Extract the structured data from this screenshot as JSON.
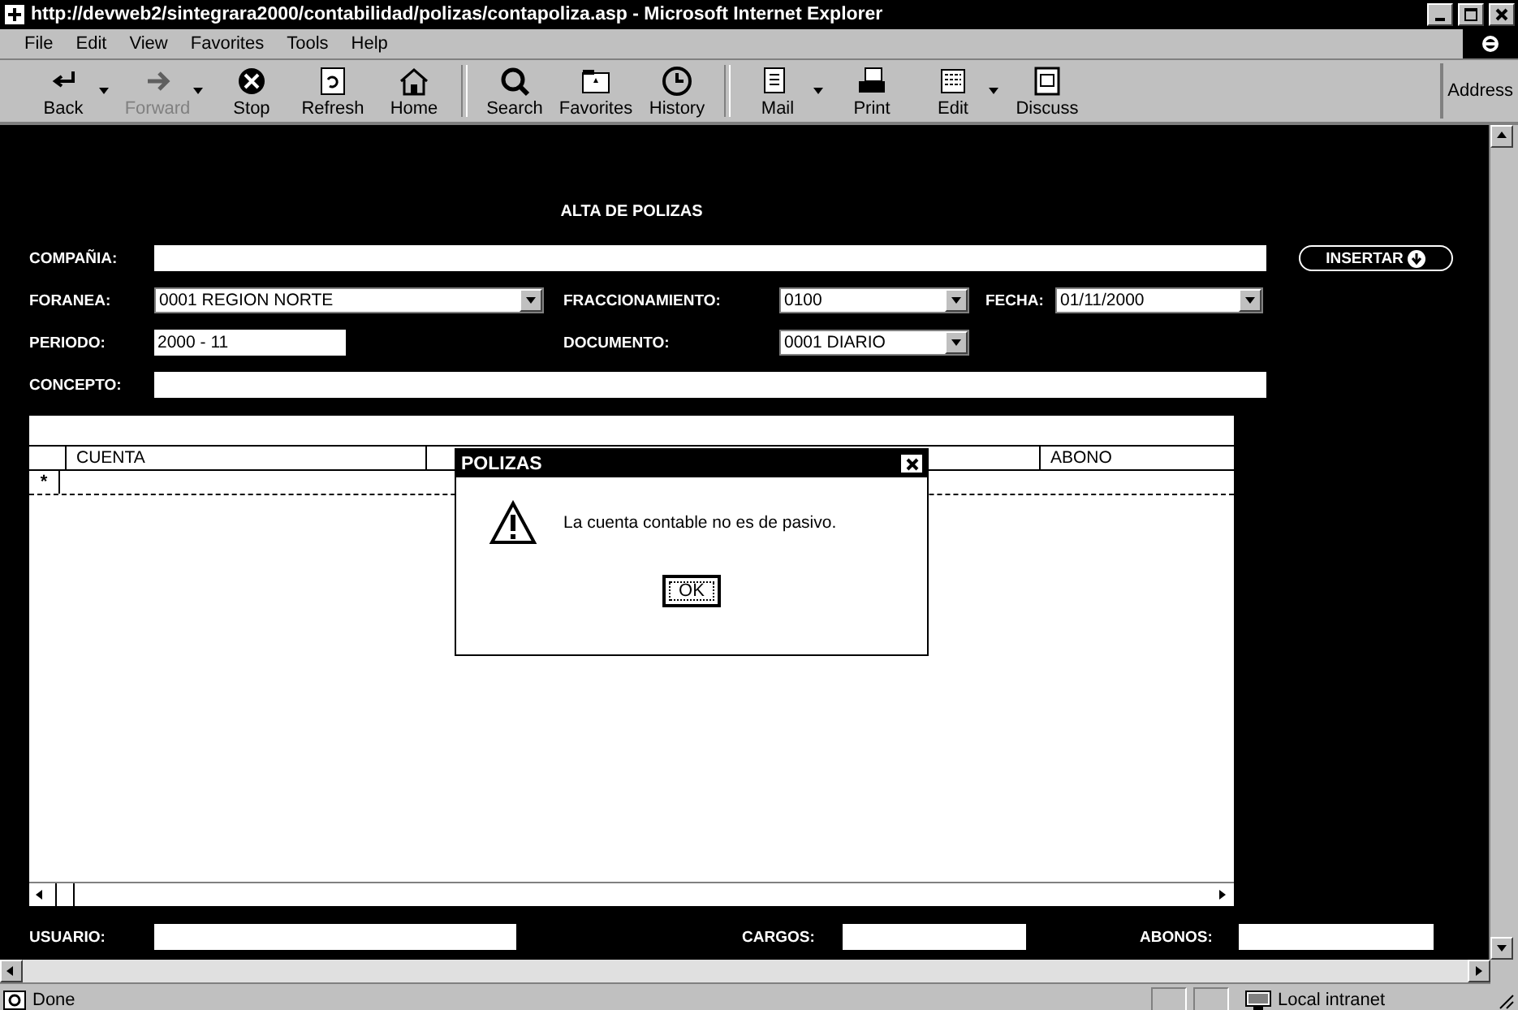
{
  "window": {
    "title": "http://devweb2/sintegrara2000/contabilidad/polizas/contapoliza.asp - Microsoft Internet Explorer"
  },
  "menu": [
    {
      "label": "File"
    },
    {
      "label": "Edit"
    },
    {
      "label": "View"
    },
    {
      "label": "Favorites"
    },
    {
      "label": "Tools"
    },
    {
      "label": "Help"
    }
  ],
  "toolbar": [
    {
      "label": "Back",
      "kind": "back",
      "dropdown": true,
      "disabled": false
    },
    {
      "label": "Forward",
      "kind": "forward",
      "dropdown": true,
      "disabled": true
    },
    {
      "label": "Stop",
      "kind": "stop",
      "dropdown": false,
      "disabled": false
    },
    {
      "label": "Refresh",
      "kind": "refresh",
      "dropdown": false,
      "disabled": false
    },
    {
      "label": "Home",
      "kind": "home",
      "dropdown": false,
      "disabled": false
    },
    {
      "label": "Search",
      "kind": "search",
      "dropdown": false,
      "disabled": false
    },
    {
      "label": "Favorites",
      "kind": "favorites",
      "dropdown": false,
      "disabled": false
    },
    {
      "label": "History",
      "kind": "history",
      "dropdown": false,
      "disabled": false
    },
    {
      "label": "Mail",
      "kind": "mail",
      "dropdown": true,
      "disabled": false
    },
    {
      "label": "Print",
      "kind": "print",
      "dropdown": false,
      "disabled": false
    },
    {
      "label": "Edit",
      "kind": "edit",
      "dropdown": true,
      "disabled": false
    },
    {
      "label": "Discuss",
      "kind": "discuss",
      "dropdown": false,
      "disabled": false
    }
  ],
  "address_label": "Address",
  "form": {
    "heading": "ALTA DE POLIZAS",
    "rows": [
      [
        {
          "kind": "label",
          "text": "COMPAÑIA:"
        },
        {
          "kind": "text"
        },
        {
          "kind": "button",
          "text": "INSERTAR"
        }
      ],
      [
        {
          "kind": "label",
          "text": "FORANEA:"
        },
        {
          "kind": "select",
          "value": "0001 REGION NORTE"
        },
        {
          "kind": "label",
          "text": "FRACCIONAMIENTO:"
        },
        {
          "kind": "select",
          "value": "0100"
        },
        {
          "kind": "label",
          "text": "FECHA:"
        },
        {
          "kind": "select",
          "value": "01/11/2000"
        }
      ],
      [
        {
          "kind": "label",
          "text": "PERIODO:"
        },
        {
          "kind": "text",
          "value": "2000 - 11"
        },
        {
          "kind": "label",
          "text": "DOCUMENTO:"
        },
        {
          "kind": "select",
          "value": "0001 DIARIO"
        }
      ],
      [
        {
          "kind": "label",
          "text": "CONCEPTO:"
        },
        {
          "kind": "text"
        }
      ]
    ]
  },
  "grid": {
    "columns": [
      "CUENTA",
      "ABONO"
    ],
    "new_row_marker": "*"
  },
  "totals": [
    {
      "label": "USUARIO:"
    },
    {
      "label": "CARGOS:"
    },
    {
      "label": "ABONOS:"
    }
  ],
  "dialog": {
    "title": "POLIZAS",
    "message": "La cuenta contable no es de pasivo.",
    "button": "OK"
  },
  "status_bar": {
    "text": "Done",
    "zone": "Local intranet"
  }
}
